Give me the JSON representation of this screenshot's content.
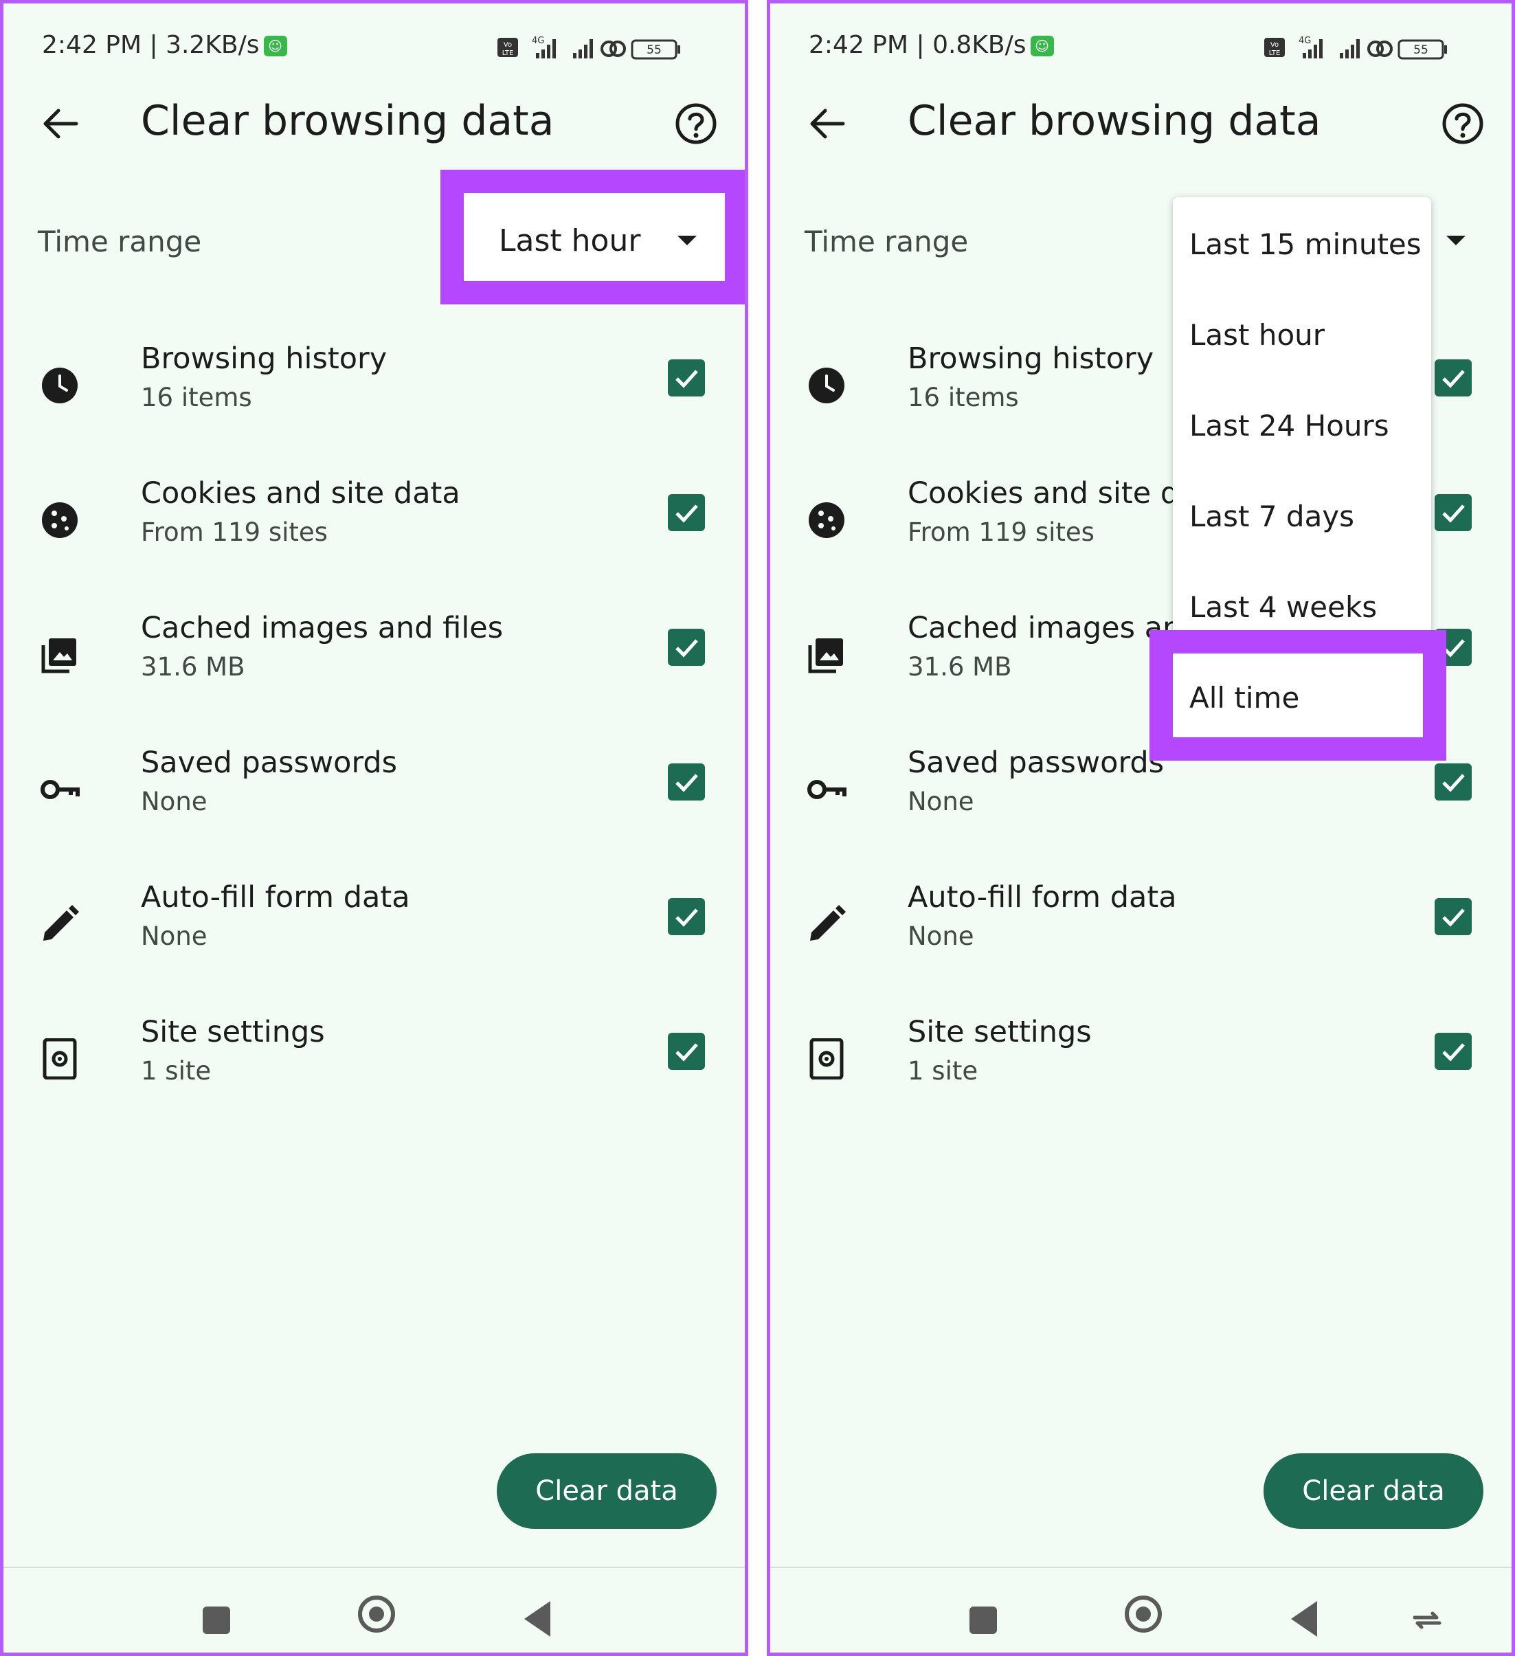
{
  "screens": [
    {
      "status": {
        "time_speed": "2:42 PM | 3.2KB/s",
        "battery": "55",
        "network": "4G"
      },
      "appbar": {
        "title": "Clear browsing data"
      },
      "time_range": {
        "label": "Time range",
        "value": "Last hour"
      },
      "items": [
        {
          "title": "Browsing history",
          "subtitle": "16 items",
          "checked": true,
          "icon": "clock-icon"
        },
        {
          "title": "Cookies and site data",
          "subtitle": "From 119 sites",
          "checked": true,
          "icon": "cookie-icon"
        },
        {
          "title": "Cached images and files",
          "subtitle": "31.6 MB",
          "checked": true,
          "icon": "images-icon"
        },
        {
          "title": "Saved passwords",
          "subtitle": "None",
          "checked": true,
          "icon": "key-icon"
        },
        {
          "title": "Auto-fill form data",
          "subtitle": "None",
          "checked": true,
          "icon": "pencil-icon"
        },
        {
          "title": "Site settings",
          "subtitle": "1 site",
          "checked": true,
          "icon": "site-settings-icon"
        }
      ],
      "button": {
        "label": "Clear data"
      }
    },
    {
      "status": {
        "time_speed": "2:42 PM | 0.8KB/s",
        "battery": "55",
        "network": "4G"
      },
      "appbar": {
        "title": "Clear browsing data"
      },
      "time_range": {
        "label": "Time range"
      },
      "menu": {
        "options": [
          "Last 15 minutes",
          "Last hour",
          "Last 24 Hours",
          "Last 7 days",
          "Last 4 weeks",
          "All time"
        ],
        "highlighted": "All time"
      },
      "items": [
        {
          "title": "Browsing history",
          "subtitle": "16 items",
          "checked": true,
          "icon": "clock-icon"
        },
        {
          "title": "Cookies and site data",
          "subtitle": "From 119 sites",
          "checked": true,
          "icon": "cookie-icon"
        },
        {
          "title": "Cached images and files",
          "subtitle": "31.6 MB",
          "checked": true,
          "icon": "images-icon"
        },
        {
          "title": "Saved passwords",
          "subtitle": "None",
          "checked": true,
          "icon": "key-icon"
        },
        {
          "title": "Auto-fill form data",
          "subtitle": "None",
          "checked": true,
          "icon": "pencil-icon"
        },
        {
          "title": "Site settings",
          "subtitle": "1 site",
          "checked": true,
          "icon": "site-settings-icon"
        }
      ],
      "button": {
        "label": "Clear data"
      }
    }
  ],
  "colors": {
    "highlight": "#b447ff",
    "accent": "#1e6b53",
    "background": "#f2fbf4"
  }
}
